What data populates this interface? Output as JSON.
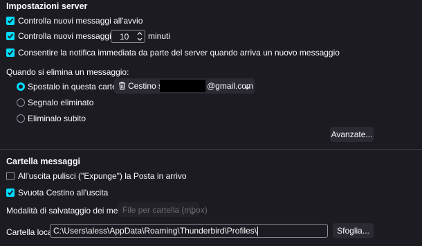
{
  "server_settings": {
    "title": "Impostazioni server",
    "check_on_startup": {
      "label": "Controlla nuovi messaggi all'avvio",
      "checked": true
    },
    "check_every": {
      "label_before": "Controlla nuovi messaggi ogni",
      "value": "10",
      "label_after": "minuti",
      "checked": true
    },
    "allow_notification": {
      "label": "Consentire la notifica immediata da parte del server quando arriva un nuovo messaggio",
      "checked": true
    },
    "delete_heading": "Quando si elimina un messaggio:",
    "delete_options": [
      {
        "label": "Spostalo in questa cartella:",
        "selected": true
      },
      {
        "label": "Segnalo eliminato",
        "selected": false
      },
      {
        "label": "Eliminalo subito",
        "selected": false
      }
    ],
    "folder_picker": {
      "prefix": "Cestino su",
      "suffix": "@gmail.com",
      "icon": "trash-icon"
    },
    "advanced_button": "Avanzate..."
  },
  "message_storage": {
    "title": "Cartella messaggi",
    "expunge_on_exit": {
      "label": "All'uscita pulisci (\"Expunge\") la Posta in arrivo",
      "checked": false
    },
    "empty_trash_on_exit": {
      "label": "Svuota Cestino all'uscita",
      "checked": true
    },
    "storage_type_label": "Modalità di salvataggio dei messaggi:",
    "storage_type_value": "File per cartella (mbox)",
    "local_dir_label": "Cartella locale:",
    "local_dir_value": "C:\\Users\\aless\\AppData\\Roaming\\Thunderbird\\Profiles\\",
    "browse_button": "Sfoglia..."
  },
  "colors": {
    "background": "#1c1b22",
    "accent": "#00ddff",
    "text": "#fbfbfe",
    "button": "#2b2a33"
  }
}
